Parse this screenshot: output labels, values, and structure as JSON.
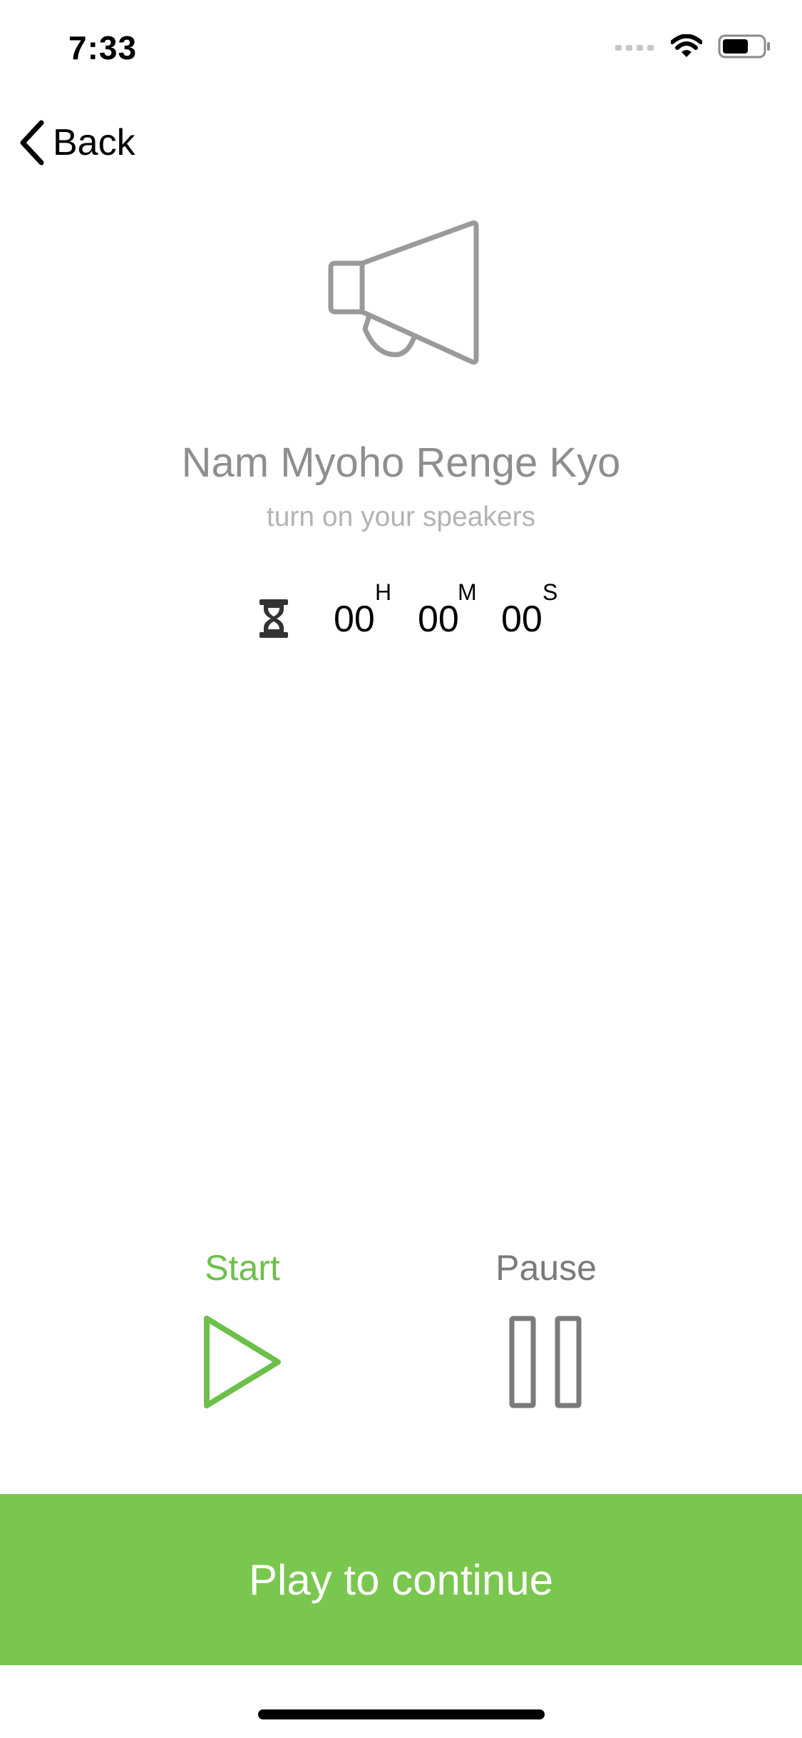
{
  "status_bar": {
    "time": "7:33",
    "icons": [
      "signal-icon",
      "wifi-icon",
      "battery-icon"
    ],
    "battery_level": 0.65
  },
  "nav": {
    "back_label": "Back"
  },
  "header": {
    "icon": "megaphone-icon",
    "title": "Nam Myoho Renge Kyo",
    "subtitle": "turn on your speakers"
  },
  "timer": {
    "icon": "hourglass-icon",
    "hours": "00",
    "hours_unit": "H",
    "minutes": "00",
    "minutes_unit": "M",
    "seconds": "00",
    "seconds_unit": "S"
  },
  "controls": {
    "start_label": "Start",
    "pause_label": "Pause",
    "start_icon": "play-icon",
    "pause_icon": "pause-icon"
  },
  "cta": {
    "label": "Play to continue"
  },
  "colors": {
    "accent_green": "#7ac74f",
    "start_green": "#6cc04a",
    "title_gray": "#8e8e8e",
    "subtitle_gray": "#b3b3b3",
    "icon_gray": "#9a9a9a"
  }
}
